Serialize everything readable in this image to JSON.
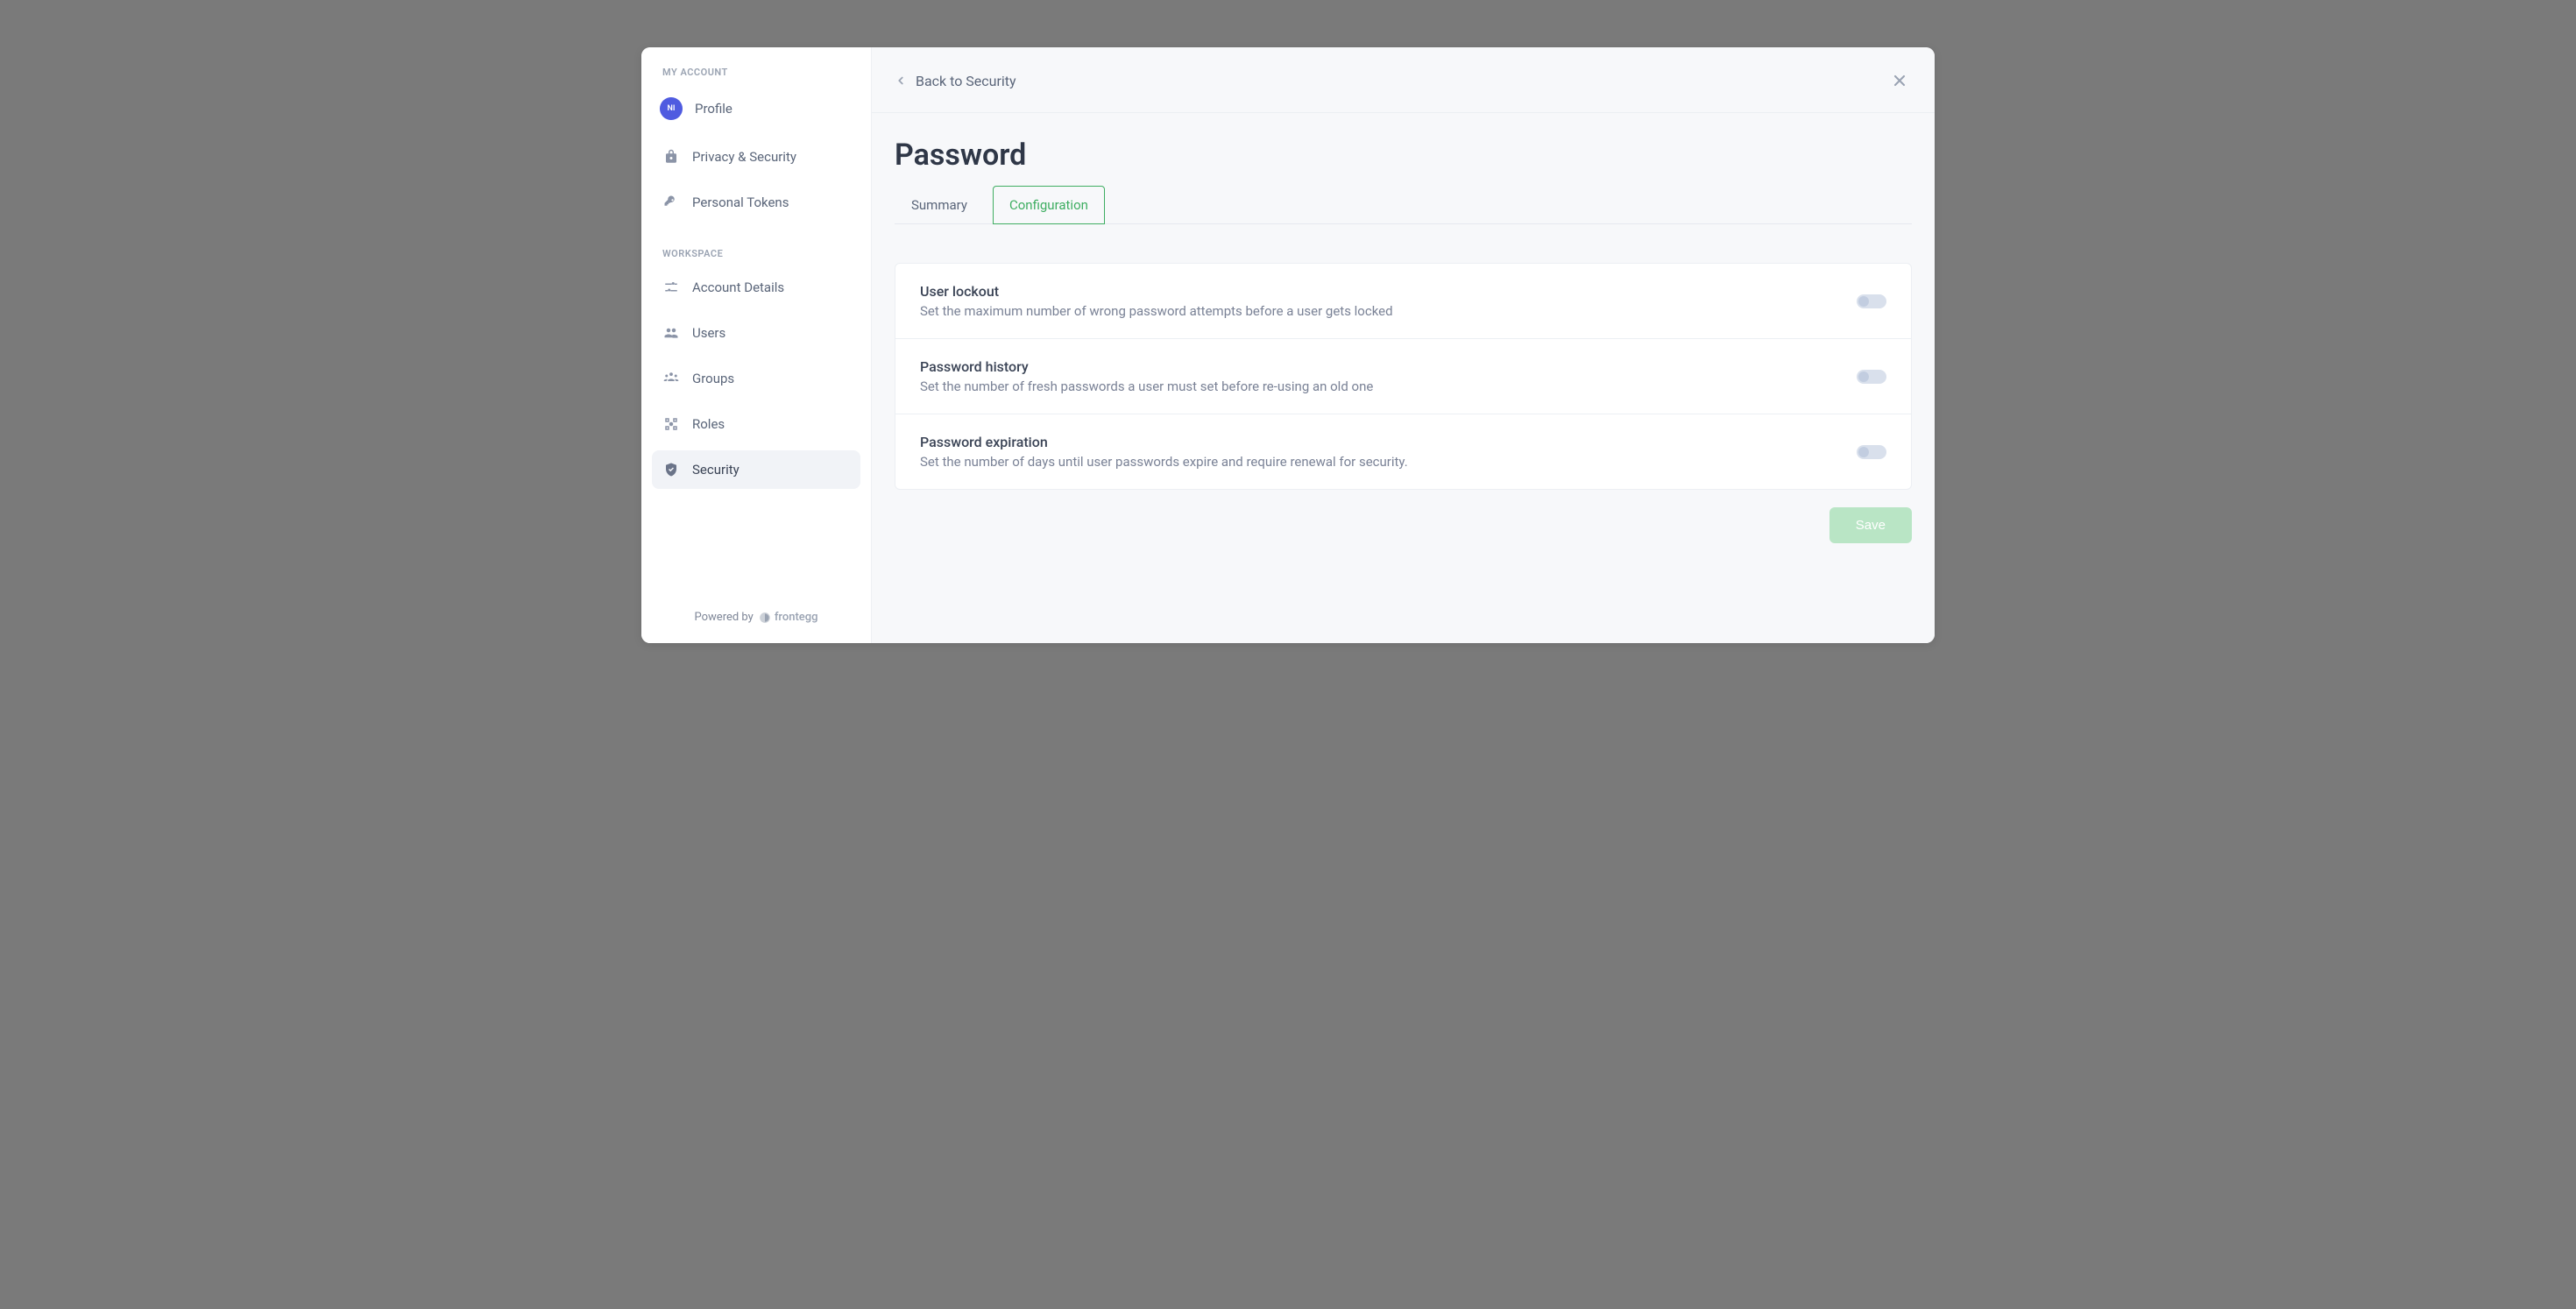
{
  "sidebar": {
    "section_my_account": "MY ACCOUNT",
    "section_workspace": "WORKSPACE",
    "avatar_initials": "NI",
    "items": {
      "profile": "Profile",
      "privacy": "Privacy & Security",
      "tokens": "Personal Tokens",
      "account_details": "Account Details",
      "users": "Users",
      "groups": "Groups",
      "roles": "Roles",
      "security": "Security"
    },
    "powered_by": "Powered by",
    "powered_brand": "frontegg"
  },
  "topbar": {
    "back_label": "Back to Security"
  },
  "page": {
    "title": "Password",
    "tabs": {
      "summary": "Summary",
      "configuration": "Configuration"
    }
  },
  "settings": {
    "user_lockout": {
      "title": "User lockout",
      "desc": "Set the maximum number of wrong password attempts before a user gets locked",
      "enabled": false
    },
    "password_history": {
      "title": "Password history",
      "desc": "Set the number of fresh passwords a user must set before re-using an old one",
      "enabled": false
    },
    "password_expiration": {
      "title": "Password expiration",
      "desc": "Set the number of days until user passwords expire and require renewal for security.",
      "enabled": false
    }
  },
  "actions": {
    "save": "Save"
  }
}
